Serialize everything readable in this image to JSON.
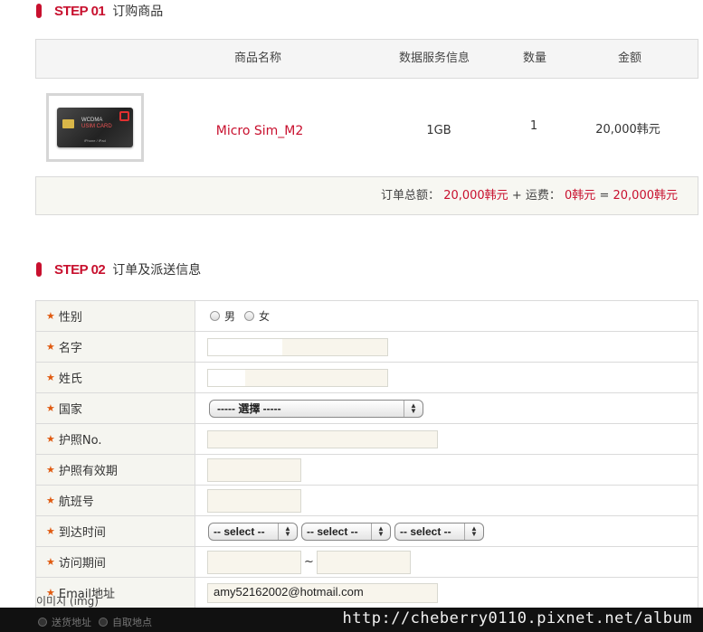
{
  "step1": {
    "no": "STEP 01",
    "title": "订购商品"
  },
  "order_table": {
    "headers": [
      "商品名称",
      "数据服务信息",
      "数量",
      "金额"
    ],
    "row": {
      "name": "Micro Sim_M2",
      "data": "1GB",
      "qty": "1",
      "price": "20,000韩元"
    },
    "product_image": {
      "line1": "WCDMA",
      "line2": "USIM CARD",
      "sub": "iPhone / iPad"
    },
    "total": {
      "label": "订单总额：",
      "order_amount": "20,000韩元",
      "plus": "+",
      "shipping_label": "运费：",
      "shipping_amount": "0韩元",
      "equals": "=",
      "grand_total": "20,000韩元"
    }
  },
  "step2": {
    "no": "STEP 02",
    "title": "订单及派送信息"
  },
  "form": {
    "required_mark": "★",
    "gender": {
      "label": "性别",
      "male": "男",
      "female": "女"
    },
    "first_name": {
      "label": "名字",
      "value": ""
    },
    "last_name": {
      "label": "姓氏",
      "value": ""
    },
    "country": {
      "label": "国家",
      "selected": "----- 選擇 -----"
    },
    "passport_no": {
      "label": "护照No.",
      "value": ""
    },
    "passport_expiry": {
      "label": "护照有效期",
      "value": ""
    },
    "flight_no": {
      "label": "航班号",
      "value": ""
    },
    "arrival_time": {
      "label": "到达时间",
      "selects": [
        "-- select --",
        "-- select --",
        "-- select --"
      ]
    },
    "visit_period": {
      "label": "访问期间",
      "from": "",
      "separator": "~",
      "to": ""
    },
    "email": {
      "label": "Email地址",
      "value": "amy52162002@hotmail.com"
    }
  },
  "img_note": "이미지 (img)",
  "delivery_options": [
    "送货地址",
    "自取地点"
  ],
  "watermark": "http://cheberry0110.pixnet.net/album",
  "colors": {
    "accent": "#c8102e",
    "required": "#e05a10"
  }
}
